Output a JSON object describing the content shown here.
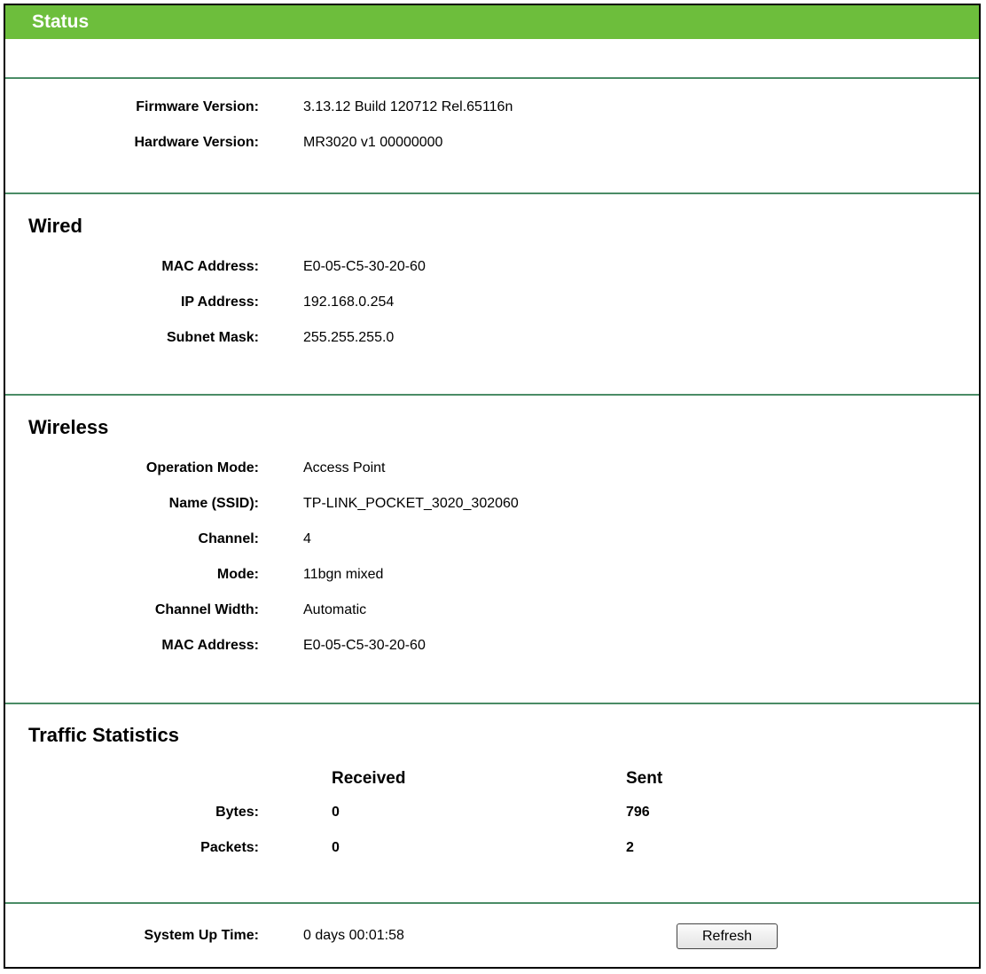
{
  "header": {
    "title": "Status"
  },
  "firmware": {
    "firmware_label": "Firmware Version:",
    "firmware_value": "3.13.12 Build 120712 Rel.65116n",
    "hardware_label": "Hardware Version:",
    "hardware_value": "MR3020 v1 00000000"
  },
  "wired": {
    "title": "Wired",
    "rows": [
      {
        "label": "MAC Address:",
        "value": "E0-05-C5-30-20-60"
      },
      {
        "label": "IP Address:",
        "value": "192.168.0.254"
      },
      {
        "label": "Subnet Mask:",
        "value": "255.255.255.0"
      }
    ]
  },
  "wireless": {
    "title": "Wireless",
    "rows": [
      {
        "label": "Operation Mode:",
        "value": "Access Point"
      },
      {
        "label": "Name (SSID):",
        "value": "TP-LINK_POCKET_3020_302060"
      },
      {
        "label": "Channel:",
        "value": "4"
      },
      {
        "label": "Mode:",
        "value": "11bgn mixed"
      },
      {
        "label": "Channel Width:",
        "value": "Automatic"
      },
      {
        "label": "MAC Address:",
        "value": "E0-05-C5-30-20-60"
      }
    ]
  },
  "traffic": {
    "title": "Traffic Statistics",
    "received_header": "Received",
    "sent_header": "Sent",
    "rows": [
      {
        "label": "Bytes:",
        "received": "0",
        "sent": "796"
      },
      {
        "label": "Packets:",
        "received": "0",
        "sent": "2"
      }
    ]
  },
  "uptime": {
    "label": "System Up Time:",
    "value": "0 days 00:01:58",
    "refresh_label": "Refresh"
  },
  "colors": {
    "title_bar": "#6dbe3c",
    "divider": "#4a8c66"
  }
}
